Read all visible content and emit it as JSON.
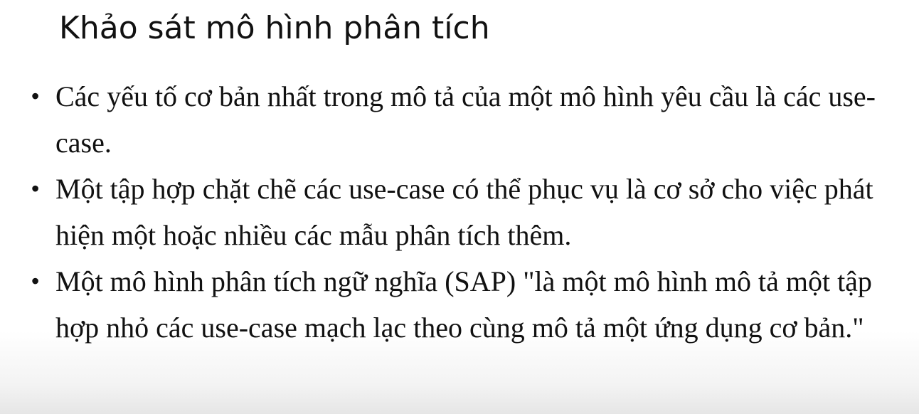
{
  "slide": {
    "title": "Khảo sát mô hình phân tích",
    "bullets": [
      "Các yếu tố cơ bản nhất trong mô tả của một mô hình yêu cầu là các use-case.",
      "Một tập hợp chặt chẽ các use-case có thể phục vụ là cơ sở cho việc phát hiện một hoặc nhiều các mẫu phân tích thêm.",
      "Một mô hình phân tích ngữ nghĩa (SAP) \"là một mô hình mô tả một tập hợp nhỏ các use-case mạch lạc theo cùng mô tả một ứng dụng cơ bản.\""
    ],
    "bullet_symbol": "•"
  }
}
